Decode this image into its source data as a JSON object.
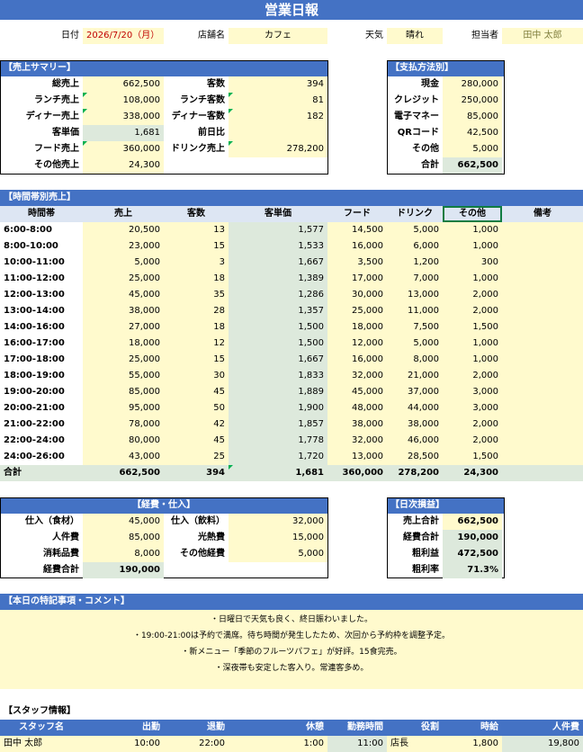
{
  "title": "営業日報",
  "info": {
    "date_label": "日付",
    "date_value": "2026/7/20（月）",
    "store_label": "店舗名",
    "store_value": "カフェ",
    "weather_label": "天気",
    "weather_value": "晴れ",
    "staff_label": "担当者",
    "staff_value": "田中 太郎"
  },
  "summary": {
    "header": "【売上サマリー】",
    "rows": [
      {
        "l1": "総売上",
        "v1": "662,500",
        "l2": "客数",
        "v2": "394"
      },
      {
        "l1": "ランチ売上",
        "v1": "108,000",
        "l2": "ランチ客数",
        "v2": "81"
      },
      {
        "l1": "ディナー売上",
        "v1": "338,000",
        "l2": "ディナー客数",
        "v2": "182"
      },
      {
        "l1": "客単価",
        "v1": "1,681",
        "l2": "前日比",
        "v2": ""
      },
      {
        "l1": "フード売上",
        "v1": "360,000",
        "l2": "ドリンク売上",
        "v2": "278,200"
      },
      {
        "l1": "その他売上",
        "v1": "24,300",
        "l2": "",
        "v2": ""
      }
    ]
  },
  "payment": {
    "header": "【支払方法別】",
    "rows": [
      {
        "label": "現金",
        "value": "280,000"
      },
      {
        "label": "クレジット",
        "value": "250,000"
      },
      {
        "label": "電子マネー",
        "value": "85,000"
      },
      {
        "label": "QRコード",
        "value": "42,500"
      },
      {
        "label": "その他",
        "value": "5,000"
      },
      {
        "label": "合計",
        "value": "662,500"
      }
    ]
  },
  "hourly": {
    "header": "【時間帯別売上】",
    "columns": [
      "時間帯",
      "売上",
      "客数",
      "客単価",
      "フード",
      "ドリンク",
      "その他",
      "備考"
    ],
    "rows": [
      [
        "6:00-8:00",
        "20,500",
        "13",
        "1,577",
        "14,500",
        "5,000",
        "1,000"
      ],
      [
        "8:00-10:00",
        "23,000",
        "15",
        "1,533",
        "16,000",
        "6,000",
        "1,000"
      ],
      [
        "10:00-11:00",
        "5,000",
        "3",
        "1,667",
        "3,500",
        "1,200",
        "300"
      ],
      [
        "11:00-12:00",
        "25,000",
        "18",
        "1,389",
        "17,000",
        "7,000",
        "1,000"
      ],
      [
        "12:00-13:00",
        "45,000",
        "35",
        "1,286",
        "30,000",
        "13,000",
        "2,000"
      ],
      [
        "13:00-14:00",
        "38,000",
        "28",
        "1,357",
        "25,000",
        "11,000",
        "2,000"
      ],
      [
        "14:00-16:00",
        "27,000",
        "18",
        "1,500",
        "18,000",
        "7,500",
        "1,500"
      ],
      [
        "16:00-17:00",
        "18,000",
        "12",
        "1,500",
        "12,000",
        "5,000",
        "1,000"
      ],
      [
        "17:00-18:00",
        "25,000",
        "15",
        "1,667",
        "16,000",
        "8,000",
        "1,000"
      ],
      [
        "18:00-19:00",
        "55,000",
        "30",
        "1,833",
        "32,000",
        "21,000",
        "2,000"
      ],
      [
        "19:00-20:00",
        "85,000",
        "45",
        "1,889",
        "45,000",
        "37,000",
        "3,000"
      ],
      [
        "20:00-21:00",
        "95,000",
        "50",
        "1,900",
        "48,000",
        "44,000",
        "3,000"
      ],
      [
        "21:00-22:00",
        "78,000",
        "42",
        "1,857",
        "38,000",
        "38,000",
        "2,000"
      ],
      [
        "22:00-24:00",
        "80,000",
        "45",
        "1,778",
        "32,000",
        "46,000",
        "2,000"
      ],
      [
        "24:00-26:00",
        "43,000",
        "25",
        "1,720",
        "13,000",
        "28,500",
        "1,500"
      ]
    ],
    "total": [
      "合計",
      "662,500",
      "394",
      "1,681",
      "360,000",
      "278,200",
      "24,300"
    ]
  },
  "expense": {
    "header": "【経費・仕入】",
    "rows": [
      {
        "l1": "仕入（食材）",
        "v1": "45,000",
        "l2": "仕入（飲料）",
        "v2": "32,000"
      },
      {
        "l1": "人件費",
        "v1": "85,000",
        "l2": "光熱費",
        "v2": "15,000"
      },
      {
        "l1": "消耗品費",
        "v1": "8,000",
        "l2": "その他経費",
        "v2": "5,000"
      },
      {
        "l1": "経費合計",
        "v1": "190,000",
        "l2": "",
        "v2": ""
      }
    ]
  },
  "pnl": {
    "header": "【日次損益】",
    "rows": [
      {
        "label": "売上合計",
        "value": "662,500"
      },
      {
        "label": "経費合計",
        "value": "190,000"
      },
      {
        "label": "粗利益",
        "value": "472,500"
      },
      {
        "label": "粗利率",
        "value": "71.3%"
      }
    ]
  },
  "notes": {
    "header": "【本日の特記事項・コメント】",
    "lines": [
      "・日曜日で天気も良く、終日賑わいました。",
      "・19:00-21:00は予約で満席。待ち時間が発生したため、次回から予約枠を調整予定。",
      "・新メニュー「季節のフルーツパフェ」が好評。15食完売。",
      "・深夜帯も安定した客入り。常連客多め。"
    ]
  },
  "staff": {
    "header": "【スタッフ情報】",
    "columns": [
      "スタッフ名",
      "出勤",
      "退勤",
      "休憩",
      "勤務時間",
      "役割",
      "時給",
      "人件費"
    ],
    "rows": [
      [
        "田中 太郎",
        "10:00",
        "22:00",
        "1:00",
        "11:00",
        "店長",
        "1,800",
        "19,800"
      ]
    ]
  },
  "colors": {
    "header_blue": "#4472c4",
    "input_yellow": "#fffacd",
    "calc_green": "#dde9dc",
    "date_red": "#c00000"
  }
}
